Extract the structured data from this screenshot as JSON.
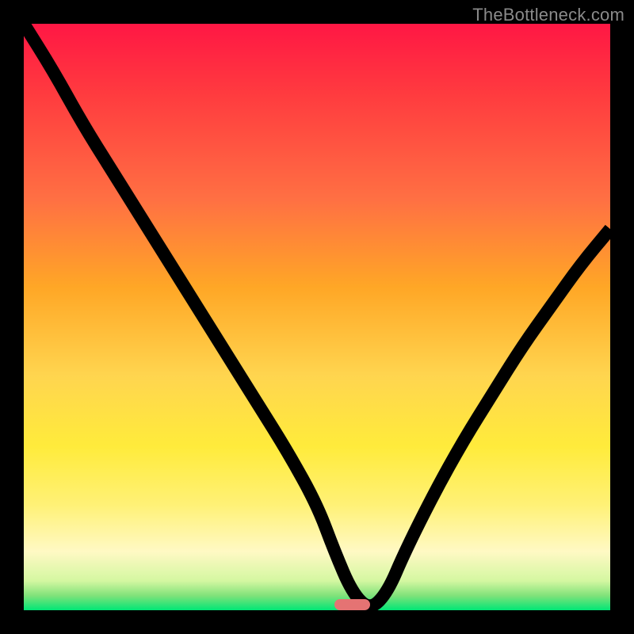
{
  "watermark": "TheBottleneck.com",
  "marker": {
    "color": "#e57373",
    "x_percent": 56,
    "width_percent": 6
  },
  "gradient_stops": [
    {
      "offset": 0.0,
      "color": "#ff1744"
    },
    {
      "offset": 0.12,
      "color": "#ff3b3f"
    },
    {
      "offset": 0.3,
      "color": "#ff7043"
    },
    {
      "offset": 0.45,
      "color": "#ffa726"
    },
    {
      "offset": 0.6,
      "color": "#ffd54f"
    },
    {
      "offset": 0.72,
      "color": "#ffeb3b"
    },
    {
      "offset": 0.82,
      "color": "#fff176"
    },
    {
      "offset": 0.9,
      "color": "#fff9c4"
    },
    {
      "offset": 0.95,
      "color": "#d4f7a1"
    },
    {
      "offset": 0.975,
      "color": "#81e27a"
    },
    {
      "offset": 1.0,
      "color": "#00e676"
    }
  ],
  "chart_data": {
    "type": "line",
    "title": "",
    "xlabel": "",
    "ylabel": "",
    "xlim": [
      0,
      100
    ],
    "ylim": [
      0,
      100
    ],
    "series": [
      {
        "name": "bottleneck-curve",
        "x": [
          0,
          5,
          10,
          15,
          20,
          25,
          30,
          35,
          40,
          45,
          50,
          53,
          56,
          59,
          62,
          65,
          70,
          75,
          80,
          85,
          90,
          95,
          100
        ],
        "values": [
          100,
          92,
          83,
          75,
          67,
          59,
          51,
          43,
          35,
          27,
          18,
          10,
          3,
          0,
          3,
          10,
          20,
          29,
          37,
          45,
          52,
          59,
          65
        ]
      }
    ],
    "annotations": [
      {
        "type": "marker",
        "x": 59,
        "label": "optimal-point"
      }
    ]
  }
}
